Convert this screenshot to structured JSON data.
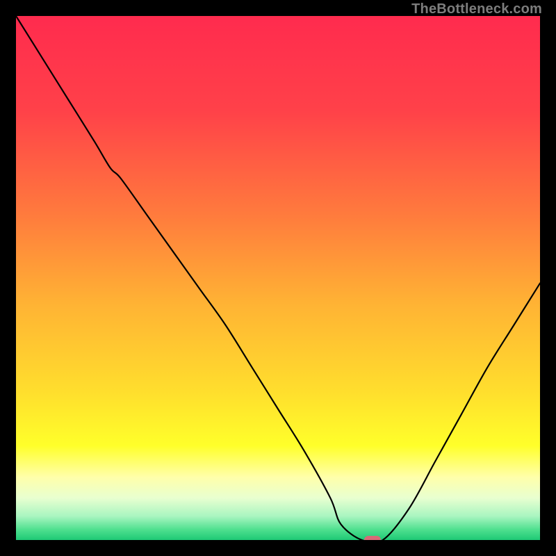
{
  "watermark": "TheBottleneck.com",
  "colors": {
    "frame": "#000000",
    "curve": "#000000",
    "marker": "#d76a77",
    "gradient_stops": [
      {
        "offset": 0.0,
        "color": "#ff2b4e"
      },
      {
        "offset": 0.18,
        "color": "#ff4149"
      },
      {
        "offset": 0.38,
        "color": "#ff7b3d"
      },
      {
        "offset": 0.55,
        "color": "#ffb334"
      },
      {
        "offset": 0.72,
        "color": "#ffdf2d"
      },
      {
        "offset": 0.82,
        "color": "#ffff2a"
      },
      {
        "offset": 0.88,
        "color": "#ffffaa"
      },
      {
        "offset": 0.92,
        "color": "#e8ffd0"
      },
      {
        "offset": 0.955,
        "color": "#a8f5c0"
      },
      {
        "offset": 0.98,
        "color": "#4fe08f"
      },
      {
        "offset": 1.0,
        "color": "#1ec975"
      }
    ]
  },
  "chart_data": {
    "type": "line",
    "title": "",
    "xlabel": "",
    "ylabel": "",
    "xlim": [
      0,
      100
    ],
    "ylim": [
      0,
      100
    ],
    "x": [
      0,
      5,
      10,
      15,
      18,
      20,
      25,
      30,
      35,
      40,
      45,
      50,
      55,
      60,
      62,
      66,
      70,
      75,
      80,
      85,
      90,
      95,
      100
    ],
    "values": [
      100,
      92,
      84,
      76,
      71,
      69,
      62,
      55,
      48,
      41,
      33,
      25,
      17,
      8,
      3,
      0,
      0,
      6,
      15,
      24,
      33,
      41,
      49
    ],
    "marker": {
      "x": 68,
      "y": 0
    },
    "annotations": [
      "TheBottleneck.com"
    ]
  }
}
